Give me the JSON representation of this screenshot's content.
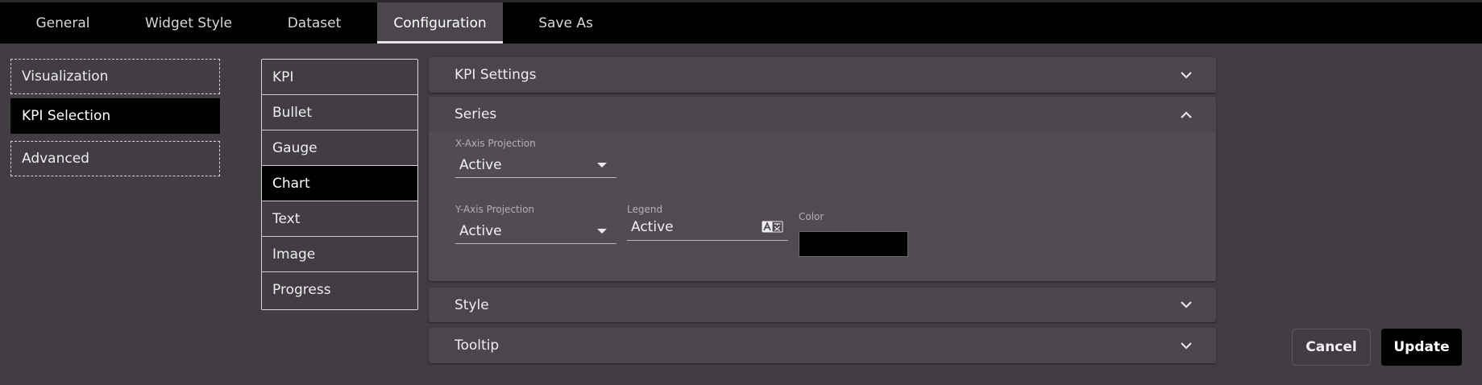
{
  "tabs": [
    {
      "label": "General"
    },
    {
      "label": "Widget Style"
    },
    {
      "label": "Dataset"
    },
    {
      "label": "Configuration",
      "active": true
    },
    {
      "label": "Save As"
    }
  ],
  "sidenav": {
    "items": [
      {
        "label": "Visualization"
      },
      {
        "label": "KPI Selection",
        "selected": true
      },
      {
        "label": "Advanced"
      }
    ]
  },
  "kpi_types": {
    "items": [
      {
        "label": "KPI"
      },
      {
        "label": "Bullet"
      },
      {
        "label": "Gauge"
      },
      {
        "label": "Chart",
        "selected": true
      },
      {
        "label": "Text"
      },
      {
        "label": "Image"
      },
      {
        "label": "Progress"
      }
    ]
  },
  "panels": {
    "kpi_settings": {
      "title": "KPI Settings",
      "expanded": false
    },
    "series": {
      "title": "Series",
      "expanded": true,
      "x_axis": {
        "label": "X-Axis Projection",
        "value": "Active"
      },
      "y_axis": {
        "label": "Y-Axis Projection",
        "value": "Active"
      },
      "legend": {
        "label": "Legend",
        "value": "Active",
        "icon": "translate-icon"
      },
      "color": {
        "label": "Color",
        "value": "#000000"
      }
    },
    "style": {
      "title": "Style",
      "expanded": false
    },
    "tooltip": {
      "title": "Tooltip",
      "expanded": false
    }
  },
  "buttons": {
    "cancel": "Cancel",
    "update": "Update"
  },
  "colors": {
    "background": "#413d42",
    "topbar": "#010101",
    "selected": "#000000",
    "panel": "#4a464c"
  }
}
